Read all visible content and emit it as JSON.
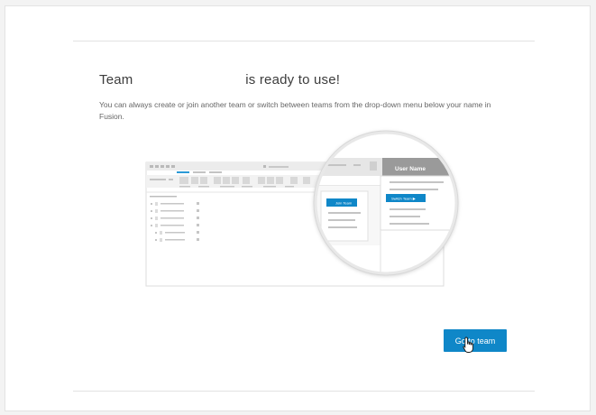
{
  "header": {
    "title_prefix": "Team",
    "title_suffix": "is ready to use!"
  },
  "description": "You can always create or join another team or switch between teams from the drop-down menu below your name in Fusion.",
  "illustration": {
    "user_name": "User Name",
    "join_team_label": "Join Team",
    "switch_team_label": "Switch Team ▶"
  },
  "cta": {
    "label": "Go to team"
  },
  "colors": {
    "accent": "#0f87c8",
    "menu_header": "#9a9a9a"
  }
}
